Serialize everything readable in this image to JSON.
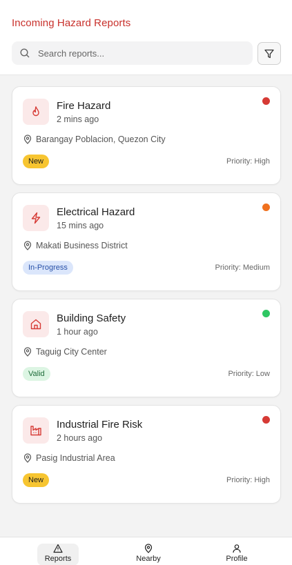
{
  "header": {
    "title": "Incoming Hazard Reports",
    "search_placeholder": "Search reports..."
  },
  "reports": [
    {
      "title": "Fire Hazard",
      "time": "2 mins ago",
      "location": "Barangay Poblacion, Quezon City",
      "status": "New",
      "priority": "Priority: High",
      "icon": "flame-icon",
      "dot_color": "#d63a35",
      "badge_bg": "#f7c531",
      "badge_fg": "#1e1e1e"
    },
    {
      "title": "Electrical Hazard",
      "time": "15 mins ago",
      "location": "Makati Business District",
      "status": "In-Progress",
      "priority": "Priority: Medium",
      "icon": "lightning-icon",
      "dot_color": "#f0711f",
      "badge_bg": "#dbe6fb",
      "badge_fg": "#2750a8"
    },
    {
      "title": "Building Safety",
      "time": "1 hour ago",
      "location": "Taguig City Center",
      "status": "Valid",
      "priority": "Priority: Low",
      "icon": "house-icon",
      "dot_color": "#2fc763",
      "badge_bg": "#dcf5e3",
      "badge_fg": "#1e6b39"
    },
    {
      "title": "Industrial Fire Risk",
      "time": "2 hours ago",
      "location": "Pasig Industrial Area",
      "status": "New",
      "priority": "Priority: High",
      "icon": "factory-icon",
      "dot_color": "#d63a35",
      "badge_bg": "#f7c531",
      "badge_fg": "#1e1e1e"
    }
  ],
  "nav": {
    "reports": "Reports",
    "nearby": "Nearby",
    "profile": "Profile"
  },
  "colors": {
    "accent": "#c8302b",
    "icon_bg": "#fbe9e9"
  }
}
